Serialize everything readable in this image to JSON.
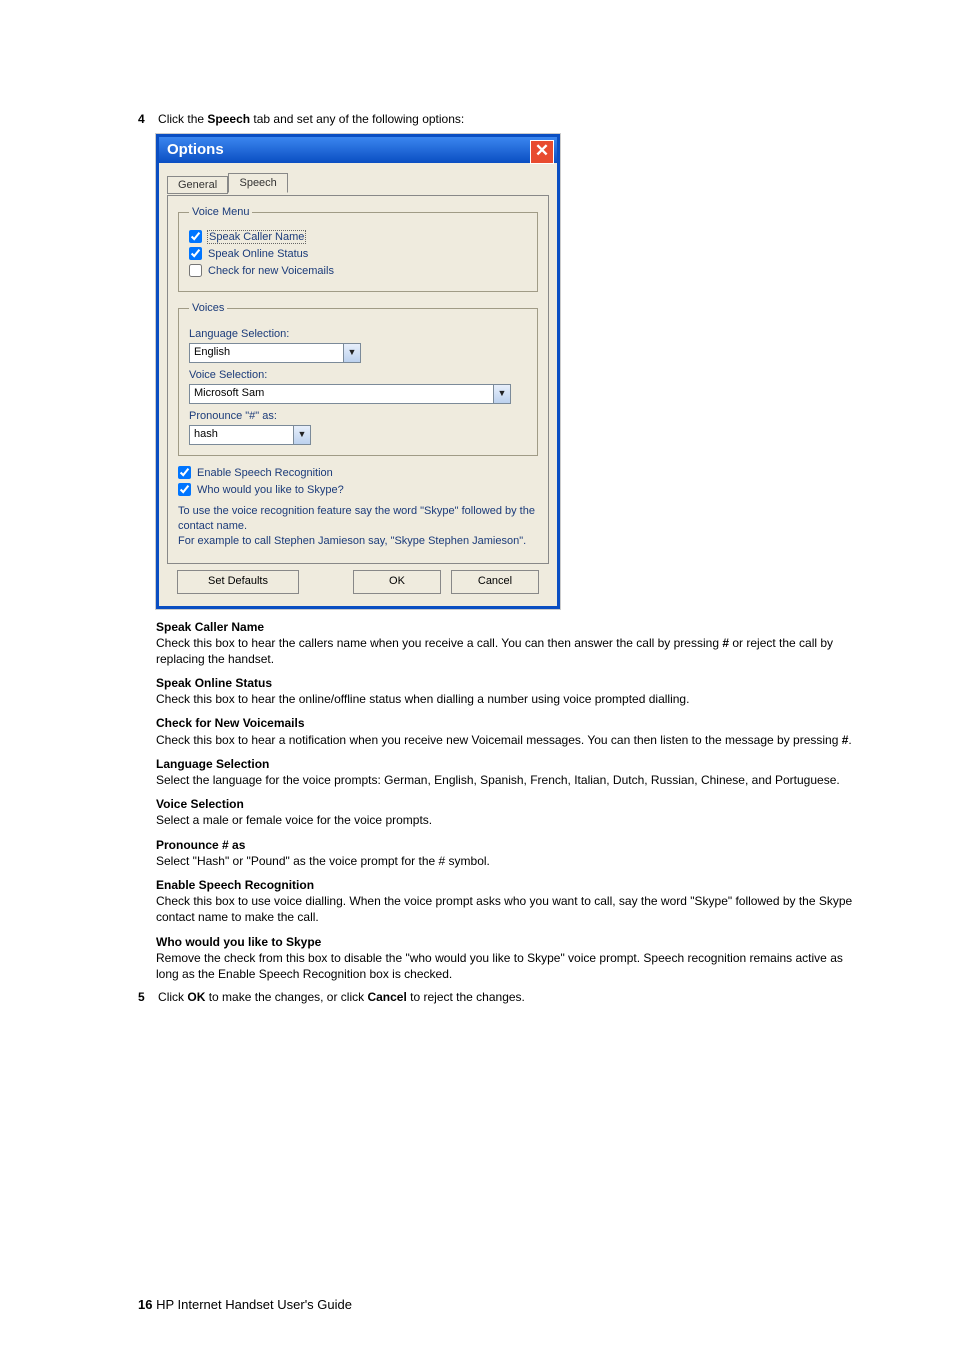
{
  "step4": {
    "num": "4",
    "pre": "Click the ",
    "bold": "Speech",
    "post": " tab and set any of the following options:"
  },
  "dialog": {
    "title": "Options",
    "close": "✕"
  },
  "tabs": {
    "general": "General",
    "speech": "Speech"
  },
  "voiceMenu": {
    "legend": "Voice Menu",
    "cb1": "Speak Caller Name",
    "cb2": "Speak Online Status",
    "cb3": "Check for new Voicemails"
  },
  "voices": {
    "legend": "Voices",
    "langLabel": "Language Selection:",
    "langValue": "English",
    "voiceLabel": "Voice Selection:",
    "voiceValue": "Microsoft Sam",
    "hashLabel": "Pronounce \"#\" as:",
    "hashValue": "hash"
  },
  "bottom": {
    "esr": "Enable Speech Recognition",
    "who": "Who would you like to Skype?",
    "instr1": "To use the voice recognition feature say the word \"Skype\" followed by the contact name.",
    "instr2": "For example to call Stephen Jamieson say, \"Skype Stephen Jamieson\"."
  },
  "buttons": {
    "defaults": "Set Defaults",
    "ok": "OK",
    "cancel": "Cancel"
  },
  "doc": {
    "scn": {
      "h": "Speak Caller Name",
      "t1": "Check this box to hear the callers name when you receive a call. You can then answer the call by pressing ",
      "b1": "#",
      "t2": " or reject the call by replacing the handset."
    },
    "sos": {
      "h": "Speak Online Status",
      "t": "Check this box to hear the online/offline status when dialling a number using voice prompted dialling."
    },
    "cnv": {
      "h": "Check for New Voicemails",
      "t1": "Check this box to hear a notification when you receive new Voicemail messages. You can then listen to the message by pressing ",
      "b1": "#",
      "t2": "."
    },
    "ls": {
      "h": "Language Selection",
      "t": "Select the language for the voice prompts: German, English, Spanish, French, Italian, Dutch, Russian, Chinese, and Portuguese."
    },
    "vs": {
      "h": "Voice Selection",
      "t": "Select a male or female voice for the voice prompts."
    },
    "pa": {
      "h": "Pronounce # as",
      "t": "Select \"Hash\" or \"Pound\" as the voice prompt for the # symbol."
    },
    "esr": {
      "h": "Enable Speech Recognition",
      "t": "Check this box to use voice dialling. When the voice prompt asks who you want to call, say the word \"Skype\" followed by the Skype contact name to make the call."
    },
    "who": {
      "h": "Who would you like to Skype",
      "t": "Remove the check from this box to disable the \"who would you like to Skype\" voice prompt. Speech recognition remains active as long as the Enable Speech Recognition box is checked."
    }
  },
  "step5": {
    "num": "5",
    "t1": "Click ",
    "b1": "OK",
    "t2": " to make the changes, or click ",
    "b2": "Cancel",
    "t3": " to reject the changes."
  },
  "footer": {
    "pg": "16",
    "title": "  HP Internet Handset User's Guide"
  }
}
